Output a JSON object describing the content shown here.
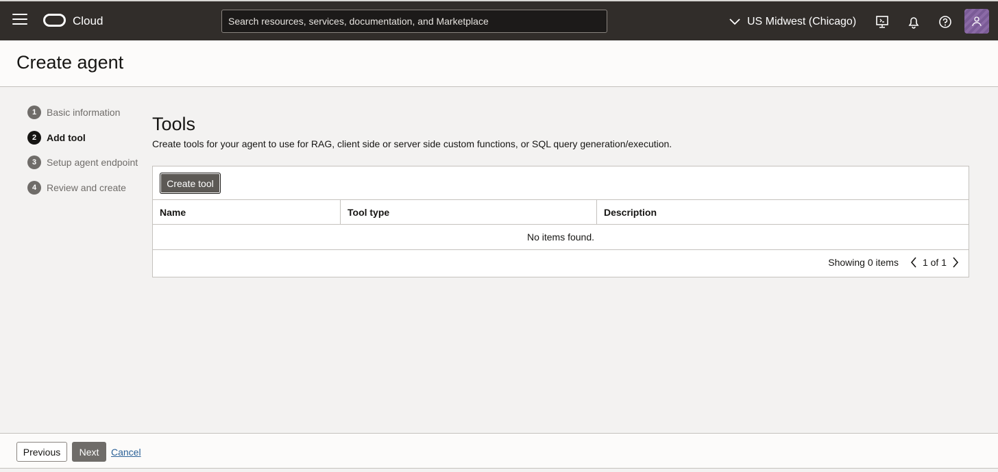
{
  "header": {
    "brand": "Cloud",
    "search_placeholder": "Search resources, services, documentation, and Marketplace",
    "region": "US Midwest (Chicago)",
    "icons": [
      "menu-icon",
      "oracle-logo",
      "chevron-down-icon",
      "cloud-shell-icon",
      "notifications-bell-icon",
      "help-icon",
      "user-avatar-icon"
    ]
  },
  "page": {
    "title": "Create agent"
  },
  "steps": [
    {
      "number": "1",
      "label": "Basic information",
      "active": false
    },
    {
      "number": "2",
      "label": "Add tool",
      "active": true
    },
    {
      "number": "3",
      "label": "Setup agent endpoint",
      "active": false
    },
    {
      "number": "4",
      "label": "Review and create",
      "active": false
    }
  ],
  "tools": {
    "title": "Tools",
    "description": "Create tools for your agent to use for RAG, client side or server side custom functions, or SQL query generation/execution.",
    "create_button": "Create tool",
    "columns": [
      "Name",
      "Tool type",
      "Description"
    ],
    "empty_message": "No items found.",
    "showing": "Showing 0 items",
    "page_indicator": "1 of 1"
  },
  "footer": {
    "previous": "Previous",
    "next": "Next",
    "cancel": "Cancel"
  },
  "colors": {
    "topbar": "#312d2a",
    "page_bg": "#f3f2f1",
    "link": "#2b6197",
    "primary_button": "#5c5955"
  }
}
